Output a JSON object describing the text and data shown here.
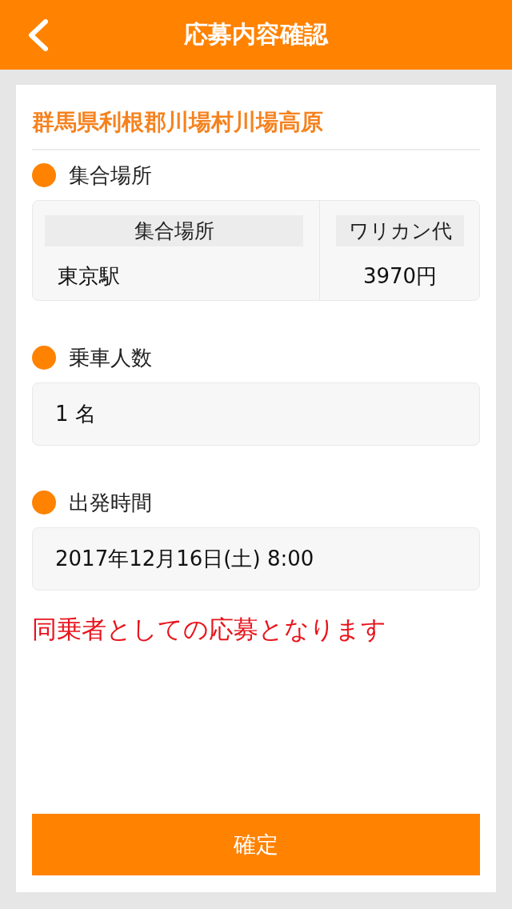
{
  "header": {
    "title": "応募内容確認"
  },
  "destination": "群馬県利根郡川場村川場高原",
  "sections": [
    {
      "kind": "table",
      "label": "集合場所",
      "columns": [
        "集合場所",
        "ワリカン代"
      ],
      "rows": [
        [
          "東京駅",
          "3970円"
        ]
      ]
    },
    {
      "kind": "field",
      "label": "乗車人数",
      "value": "1 名"
    },
    {
      "kind": "field",
      "label": "出発時間",
      "value": "2017年12月16日(土) 8:00"
    }
  ],
  "notice": "同乗者としての応募となります",
  "confirm_button": "確定"
}
